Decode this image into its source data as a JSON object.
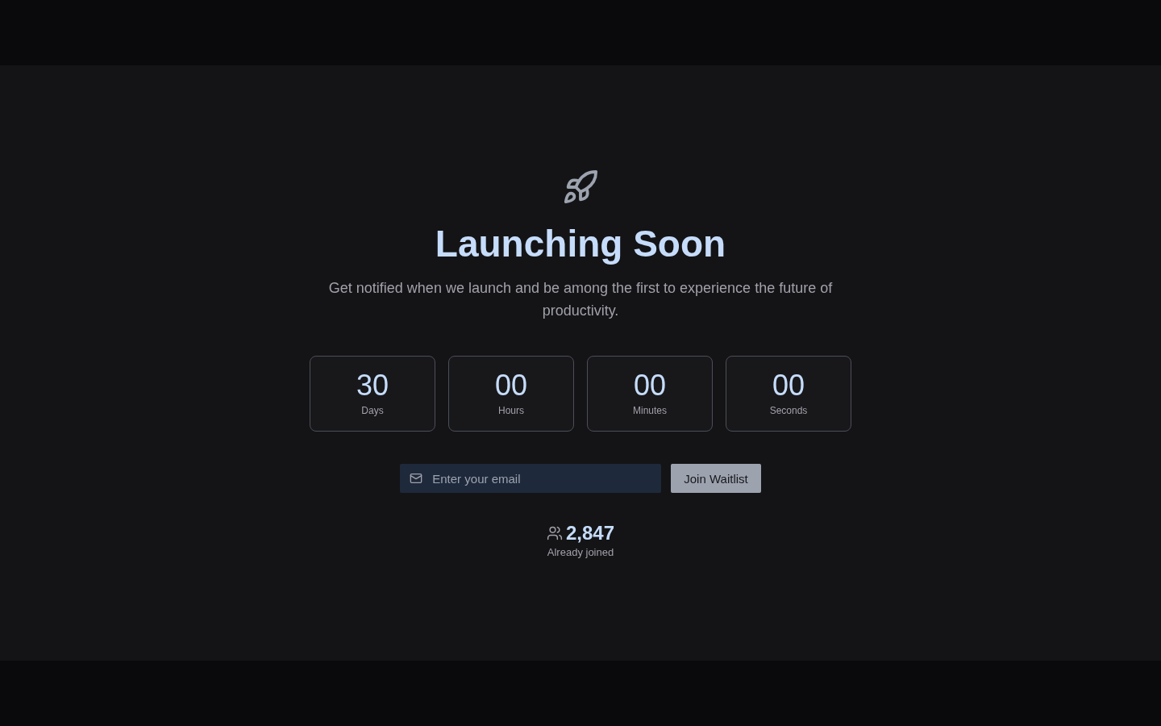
{
  "hero": {
    "title": "Launching Soon",
    "subtitle": "Get notified when we launch and be among the first to experience the future of productivity."
  },
  "countdown": [
    {
      "value": "30",
      "unit": "Days"
    },
    {
      "value": "00",
      "unit": "Hours"
    },
    {
      "value": "00",
      "unit": "Minutes"
    },
    {
      "value": "00",
      "unit": "Seconds"
    }
  ],
  "signup": {
    "placeholder": "Enter your email",
    "button": "Join Waitlist"
  },
  "joined": {
    "count": "2,847",
    "label": "Already joined"
  }
}
